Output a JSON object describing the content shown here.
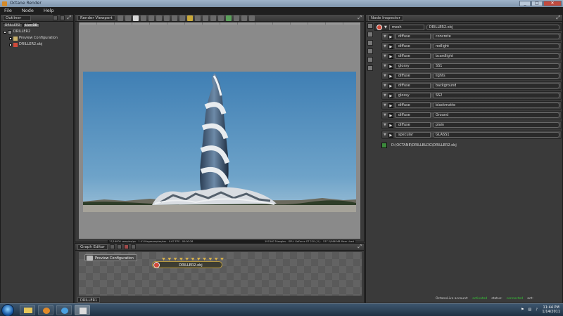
{
  "window": {
    "title": "Octane Render",
    "buttons": [
      "_",
      "□",
      "✕"
    ]
  },
  "menu": [
    "File",
    "Node",
    "Help"
  ],
  "outliner": {
    "title": "Outliner",
    "tabs": [
      "DRILLER2",
      "Live DB"
    ],
    "tree": [
      {
        "label": "DRILLER2",
        "icon": "scene-icon",
        "indent": 0
      },
      {
        "label": "Preview Configuration",
        "icon": "pencil-icon",
        "indent": 1
      },
      {
        "label": "DRILLER2.obj",
        "icon": "mesh-icon",
        "indent": 1
      }
    ]
  },
  "viewport": {
    "title": "Render Viewport",
    "status_left": "17/16000 samples/px - 1.41 Megasamples/sec - 0.67 FPS - 00:00:26",
    "status_right": "197440 Triangles - GPU: GeForce GT 220 ( 0 ) - 537.2/986 MB Mem Used"
  },
  "graph": {
    "title": "Graph Editor",
    "nodes": {
      "preview": "Preview Configuration",
      "mesh": "DRILLER2.obj"
    },
    "footer": "DRILLER1"
  },
  "inspector": {
    "title": "Node Inspector",
    "mesh_type": "mesh",
    "mesh_name": "DRILLER2.obj",
    "materials": [
      {
        "type": "diffuse",
        "name": "concrete"
      },
      {
        "type": "diffuse",
        "name": "redlight"
      },
      {
        "type": "diffuse",
        "name": "bcardlight"
      },
      {
        "type": "glossy",
        "name": "SS1"
      },
      {
        "type": "diffuse",
        "name": "lights"
      },
      {
        "type": "diffuse",
        "name": "background"
      },
      {
        "type": "glossy",
        "name": "SS2"
      },
      {
        "type": "diffuse",
        "name": "blackmatte"
      },
      {
        "type": "diffuse",
        "name": "Ground"
      },
      {
        "type": "diffuse",
        "name": "plain"
      },
      {
        "type": "specular",
        "name": "GLASS1"
      }
    ],
    "mesh_path": "D:\\OCTANE\\DRILLBLDG\\DRILLER2.obj"
  },
  "status": {
    "account_label": "OctaneLive account:",
    "account_value": "activated",
    "status_label": "status:",
    "status_value": "connected",
    "act_label": "act:"
  },
  "taskbar": {
    "time": "11:44 PM",
    "date": "1/14/2011"
  },
  "colors": {
    "accent_green": "#37c337",
    "panel": "#3a3a3a",
    "sky": "#4e88b8"
  }
}
